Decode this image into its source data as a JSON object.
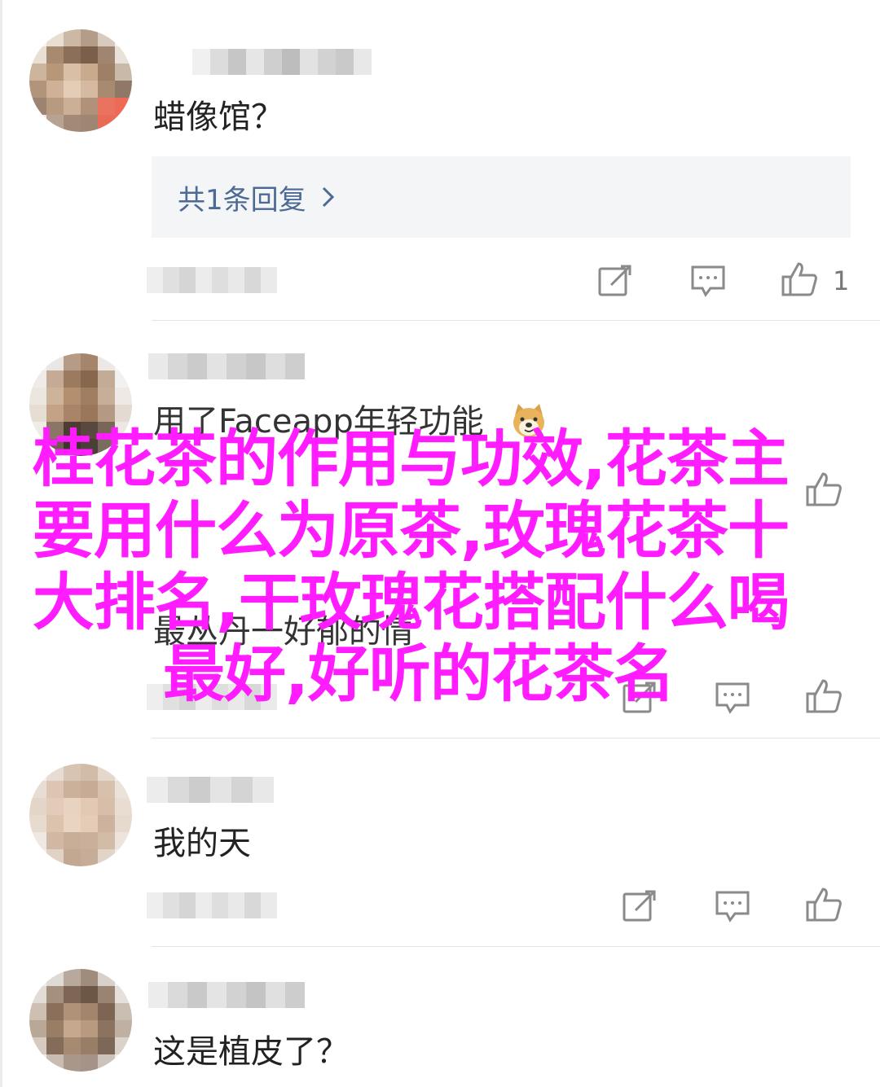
{
  "comments": [
    {
      "text": "蜡像馆？",
      "reply_summary": "共1条回复",
      "like_count": "1"
    },
    {
      "text": "用了Faceapp年轻功能",
      "emoji": "dog-face",
      "second_line": "最丛丹一好郁的情"
    },
    {
      "text": "我的天"
    },
    {
      "text": "这是植皮了？"
    }
  ],
  "overlay": {
    "line1": "桂花茶的作用与功效,花茶主",
    "line2": "要用什么为原茶,玫瑰花茶十",
    "line3": "大排名,干玫瑰花搭配什么喝",
    "line4": "最好,好听的花茶名"
  },
  "icons": {
    "edit": "edit-icon",
    "comment": "comment-icon",
    "like": "thumbs-up-icon",
    "chevron": "chevron-right-icon"
  },
  "colors": {
    "overlay_text": "#ff1dff",
    "reply_link": "#4d6a94",
    "icon_gray": "#8a8a8a"
  }
}
